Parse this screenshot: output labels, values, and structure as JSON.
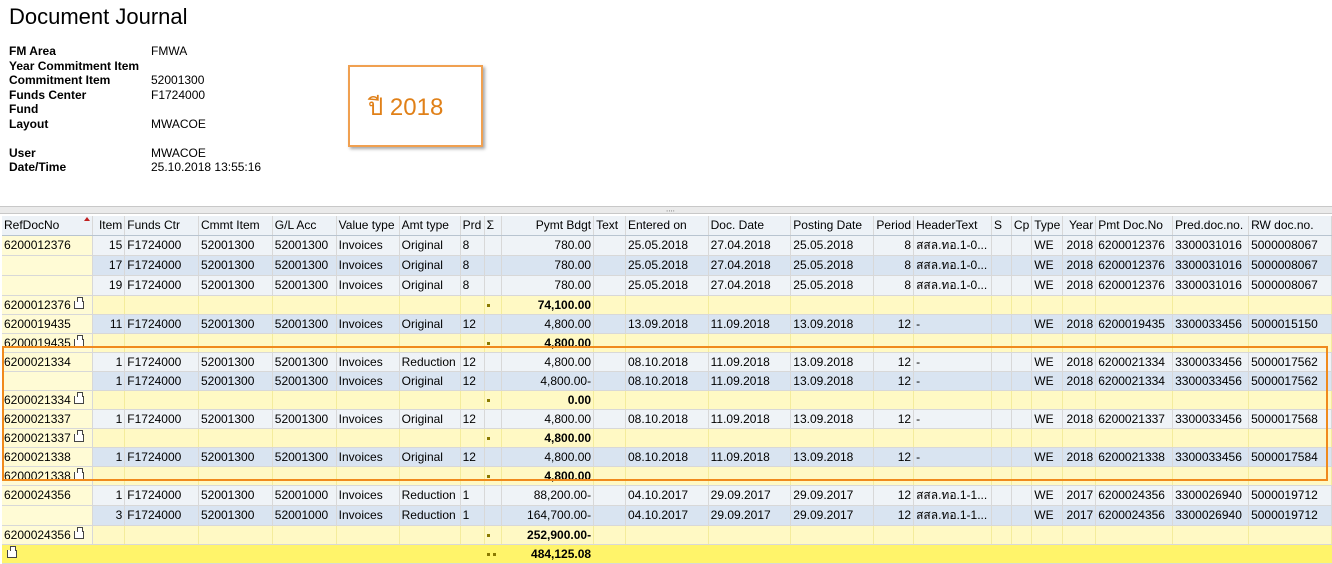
{
  "title": "Document Journal",
  "header": {
    "fm_area_label": "FM Area",
    "fm_area": "FMWA",
    "year_ci_label": "Year Commitment Item",
    "year_ci": "",
    "commit_item_label": "Commitment Item",
    "commit_item": "52001300",
    "funds_center_label": "Funds Center",
    "funds_center": "F1724000",
    "fund_label": "Fund",
    "fund": "",
    "layout_label": "Layout",
    "layout": "MWACOE",
    "user_label": "User",
    "user": "MWACOE",
    "datetime_label": "Date/Time",
    "datetime": "25.10.2018 13:55:16"
  },
  "annotation": {
    "text": "ปี 2018",
    "color": "#e08018"
  },
  "colors": {
    "highlight_border": "#f08a1c",
    "subtotal_bg": "#fff9c4",
    "total_bg": "#fff46a",
    "row_a": "#eff3f7",
    "row_b": "#d9e4f1"
  },
  "grid": {
    "columns": [
      "RefDocNo",
      "Item",
      "Funds Ctr",
      "Cmmt Item",
      "G/L Acc",
      "Value type",
      "Amt type",
      "Prd",
      "Σ",
      "Pymt Bdgt",
      "Text",
      "Entered on",
      "Doc. Date",
      "Posting Date",
      "Period",
      "HeaderText",
      "S",
      "Cp",
      "Type",
      "Year",
      "Pmt Doc.No",
      "Pred.doc.no.",
      "RW doc.no."
    ],
    "rows": [
      {
        "ref": "6200012376",
        "cells": [
          "15",
          "F1724000",
          "52001300",
          "52001300",
          "Invoices",
          "Original",
          "8",
          "",
          "780.00",
          "",
          "25.05.2018",
          "27.04.2018",
          "25.05.2018",
          "8",
          "สสล.ทอ.1-0...",
          "",
          "",
          "WE",
          "2018",
          "6200012376",
          "3300031016",
          "5000008067"
        ]
      },
      {
        "ref": "",
        "cells": [
          "17",
          "F1724000",
          "52001300",
          "52001300",
          "Invoices",
          "Original",
          "8",
          "",
          "780.00",
          "",
          "25.05.2018",
          "27.04.2018",
          "25.05.2018",
          "8",
          "สสล.ทอ.1-0...",
          "",
          "",
          "WE",
          "2018",
          "6200012376",
          "3300031016",
          "5000008067"
        ]
      },
      {
        "ref": "",
        "cells": [
          "19",
          "F1724000",
          "52001300",
          "52001300",
          "Invoices",
          "Original",
          "8",
          "",
          "780.00",
          "",
          "25.05.2018",
          "27.04.2018",
          "25.05.2018",
          "8",
          "สสล.ทอ.1-0...",
          "",
          "",
          "WE",
          "2018",
          "6200012376",
          "3300031016",
          "5000008067"
        ]
      },
      {
        "subtotal_ref": "6200012376",
        "subtotal": "74,100.00"
      },
      {
        "ref": "6200019435",
        "cells": [
          "11",
          "F1724000",
          "52001300",
          "52001300",
          "Invoices",
          "Original",
          "12",
          "",
          "4,800.00",
          "",
          "13.09.2018",
          "11.09.2018",
          "13.09.2018",
          "12",
          "-",
          "",
          "",
          "WE",
          "2018",
          "6200019435",
          "3300033456",
          "5000015150"
        ]
      },
      {
        "subtotal_ref": "6200019435",
        "subtotal": "4,800.00"
      },
      {
        "ref": "6200021334",
        "cells": [
          "1",
          "F1724000",
          "52001300",
          "52001300",
          "Invoices",
          "Reduction",
          "12",
          "",
          "4,800.00",
          "",
          "08.10.2018",
          "11.09.2018",
          "13.09.2018",
          "12",
          "-",
          "",
          "",
          "WE",
          "2018",
          "6200021334",
          "3300033456",
          "5000017562"
        ]
      },
      {
        "ref": "",
        "cells": [
          "1",
          "F1724000",
          "52001300",
          "52001300",
          "Invoices",
          "Original",
          "12",
          "",
          "4,800.00-",
          "",
          "08.10.2018",
          "11.09.2018",
          "13.09.2018",
          "12",
          "-",
          "",
          "",
          "WE",
          "2018",
          "6200021334",
          "3300033456",
          "5000017562"
        ]
      },
      {
        "subtotal_ref": "6200021334",
        "subtotal": "0.00"
      },
      {
        "ref": "6200021337",
        "cells": [
          "1",
          "F1724000",
          "52001300",
          "52001300",
          "Invoices",
          "Original",
          "12",
          "",
          "4,800.00",
          "",
          "08.10.2018",
          "11.09.2018",
          "13.09.2018",
          "12",
          "-",
          "",
          "",
          "WE",
          "2018",
          "6200021337",
          "3300033456",
          "5000017568"
        ]
      },
      {
        "subtotal_ref": "6200021337",
        "subtotal": "4,800.00"
      },
      {
        "ref": "6200021338",
        "cells": [
          "1",
          "F1724000",
          "52001300",
          "52001300",
          "Invoices",
          "Original",
          "12",
          "",
          "4,800.00",
          "",
          "08.10.2018",
          "11.09.2018",
          "13.09.2018",
          "12",
          "-",
          "",
          "",
          "WE",
          "2018",
          "6200021338",
          "3300033456",
          "5000017584"
        ]
      },
      {
        "subtotal_ref": "6200021338",
        "subtotal": "4,800.00"
      },
      {
        "ref": "6200024356",
        "cells": [
          "1",
          "F1724000",
          "52001300",
          "52001000",
          "Invoices",
          "Reduction",
          "1",
          "",
          "88,200.00-",
          "",
          "04.10.2017",
          "29.09.2017",
          "29.09.2017",
          "12",
          "สสล.ทอ.1-1...",
          "",
          "",
          "WE",
          "2017",
          "6200024356",
          "3300026940",
          "5000019712"
        ]
      },
      {
        "ref": "",
        "cells": [
          "3",
          "F1724000",
          "52001300",
          "52001000",
          "Invoices",
          "Reduction",
          "1",
          "",
          "164,700.00-",
          "",
          "04.10.2017",
          "29.09.2017",
          "29.09.2017",
          "12",
          "สสล.ทอ.1-1...",
          "",
          "",
          "WE",
          "2017",
          "6200024356",
          "3300026940",
          "5000019712"
        ]
      },
      {
        "subtotal_ref": "6200024356",
        "subtotal": "252,900.00-"
      },
      {
        "total": "484,125.08"
      }
    ]
  }
}
